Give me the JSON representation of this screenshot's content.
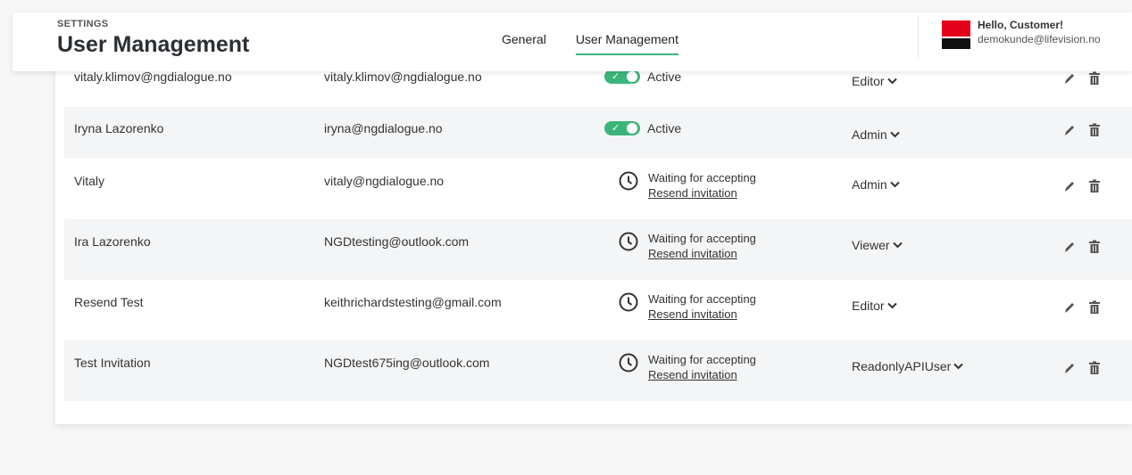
{
  "header": {
    "caption": "SETTINGS",
    "title": "User Management",
    "tabs": [
      {
        "label": "General"
      },
      {
        "label": "User Management"
      }
    ],
    "user": {
      "greeting": "Hello, Customer!",
      "email": "demokunde@lifevision.no"
    }
  },
  "users": [
    {
      "name": "vitaly.klimov@ngdialogue.no",
      "email": "vitaly.klimov@ngdialogue.no",
      "status": "Active",
      "role": "Editor"
    },
    {
      "name": "Iryna Lazorenko",
      "email": "iryna@ngdialogue.no",
      "status": "Active",
      "role": "Admin"
    },
    {
      "name": "Vitaly",
      "email": "vitaly@ngdialogue.no",
      "status": "Waiting for accepting",
      "resend": "Resend invitation",
      "role": "Admin"
    },
    {
      "name": "Ira Lazorenko",
      "email": "NGDtesting@outlook.com",
      "status": "Waiting for accepting",
      "resend": "Resend invitation",
      "role": "Viewer"
    },
    {
      "name": "Resend Test",
      "email": "keithrichardstesting@gmail.com",
      "status": "Waiting for accepting",
      "resend": "Resend invitation",
      "role": "Editor"
    },
    {
      "name": "Test Invitation",
      "email": "NGDtest675ing@outlook.com",
      "status": "Waiting for accepting",
      "resend": "Resend invitation",
      "role": "ReadonlyAPIUser"
    }
  ],
  "icons": {
    "active_toggle": "toggle-on-icon",
    "waiting": "clock-icon",
    "role_dropdown": "chevron-down-icon",
    "edit": "pencil-icon",
    "delete": "trash-icon"
  },
  "colors": {
    "accent": "#3ab67a",
    "brand_red": "#e4001b",
    "row_shade": "#f4f5f6"
  }
}
